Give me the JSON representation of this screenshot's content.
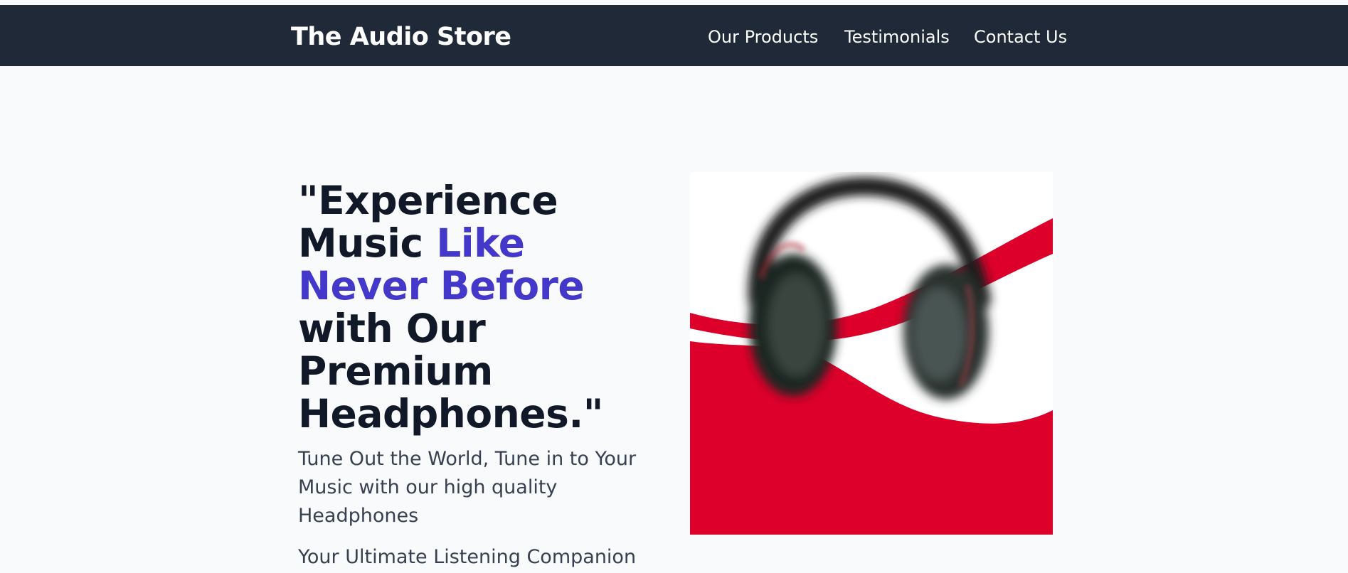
{
  "header": {
    "brand": "The Audio Store",
    "nav": [
      {
        "label": "Our Products"
      },
      {
        "label": "Testimonials"
      },
      {
        "label": "Contact Us"
      }
    ]
  },
  "hero": {
    "headline": {
      "part1": "\"Experience Music ",
      "accent": "Like Never Before",
      "part2": " with Our Premium Headphones.\""
    },
    "subtitle": "Tune Out the World, Tune in to Your Music with our high quality Headphones",
    "tagline": "Your Ultimate Listening Companion",
    "image_icon": "headphones-image"
  },
  "colors": {
    "navbar_bg": "#1f2937",
    "page_bg": "#f8fafc",
    "headline": "#111827",
    "accent": "#4338ca",
    "body_text": "#374151",
    "image_red": "#dc002b"
  }
}
